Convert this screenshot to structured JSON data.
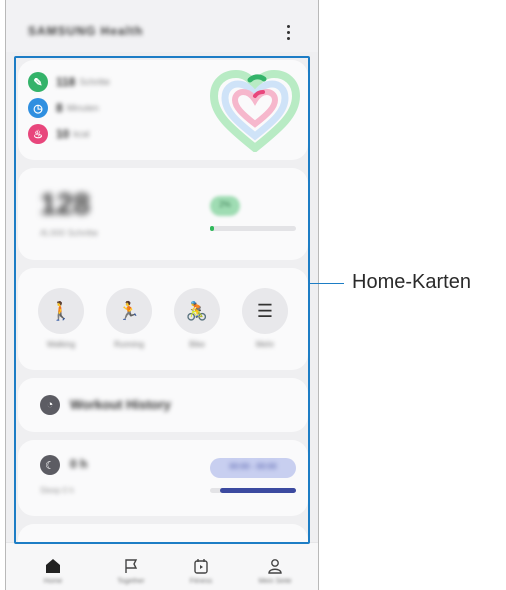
{
  "app": {
    "title": "SAMSUNG Health",
    "menu_icon": "more-vert-icon"
  },
  "summary": {
    "items": [
      {
        "icon": "footprint-icon",
        "color": "#34b36a",
        "value": "118",
        "unit": "Schritte"
      },
      {
        "icon": "clock-icon",
        "color": "#2f8fe0",
        "value": "8",
        "unit": "Minuten"
      },
      {
        "icon": "flame-icon",
        "color": "#e8467c",
        "value": "10",
        "unit": "kcal"
      }
    ],
    "rings_colors": [
      "#b8ebc4",
      "#cfe3f8",
      "#f6b7cc"
    ]
  },
  "steps": {
    "value": "128",
    "goal_text": "/6.000 Schritte",
    "badge": "2%",
    "progress": 0.02
  },
  "workouts": [
    {
      "name": "walk-icon",
      "label": "Walking"
    },
    {
      "name": "run-icon",
      "label": "Running"
    },
    {
      "name": "bike-icon",
      "label": "Bike"
    },
    {
      "name": "list-icon",
      "label": "Mehr"
    }
  ],
  "history": {
    "label": "Workout History"
  },
  "sleep": {
    "value": "0 h",
    "sub": "Sleep 0 h",
    "pill": "00:00 - 00:00",
    "progress": 0.88
  },
  "nav": [
    {
      "icon": "home-icon",
      "label": "Home",
      "active": true
    },
    {
      "icon": "flag-icon",
      "label": "Together"
    },
    {
      "icon": "fitness-icon",
      "label": "Fitness"
    },
    {
      "icon": "person-icon",
      "label": "Mein Seite"
    }
  ],
  "annotation": {
    "label": "Home-Karten"
  }
}
